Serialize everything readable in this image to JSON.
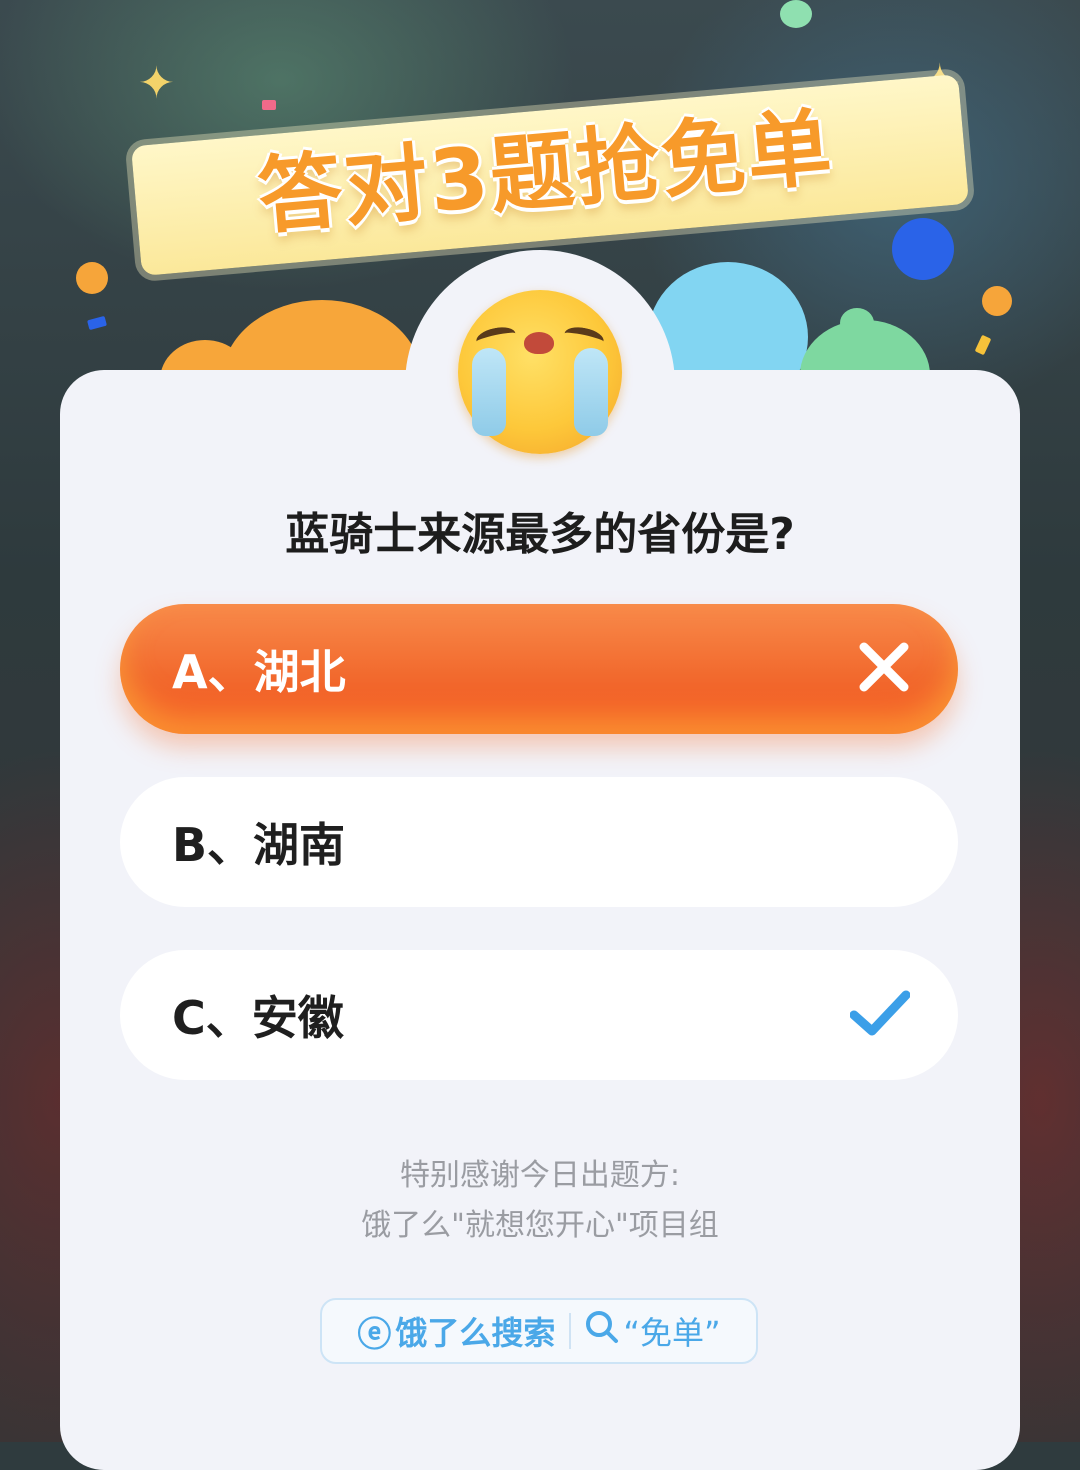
{
  "banner": {
    "title": "答对3题抢免单"
  },
  "quiz": {
    "question": "蓝骑士来源最多的省份是?",
    "options": [
      {
        "label": "A、湖北",
        "state": "wrong",
        "mark_icon": "x-icon"
      },
      {
        "label": "B、湖南",
        "state": "neutral"
      },
      {
        "label": "C、安徽",
        "state": "correct",
        "mark_icon": "check-icon"
      }
    ]
  },
  "thanks": {
    "line1": "特别感谢今日出题方:",
    "line2": "饿了么\"就想您开心\"项目组"
  },
  "search": {
    "brand": "饿了么搜索",
    "query": "“免单”"
  },
  "colors": {
    "wrong": "#f26a2e",
    "correct": "#3b9fe8",
    "banner_text": "#f79a2a",
    "card_bg": "#f2f3f9"
  }
}
